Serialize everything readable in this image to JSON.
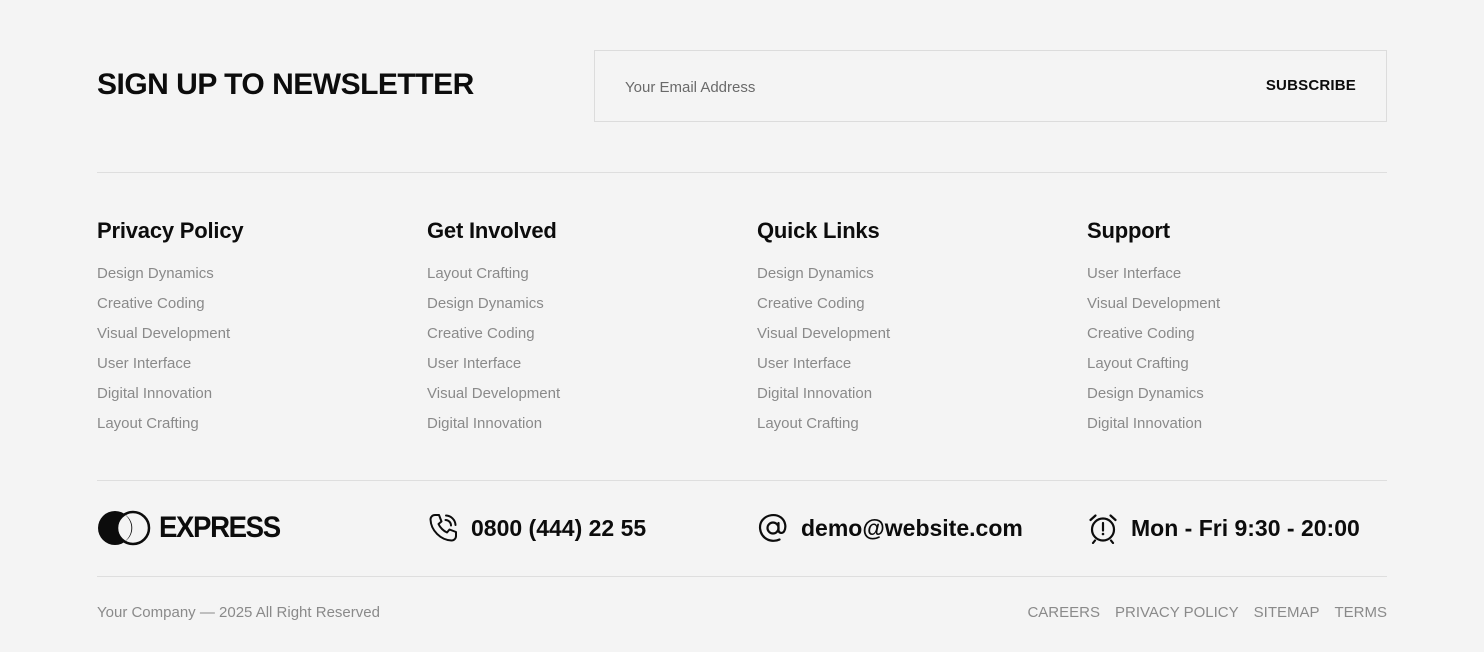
{
  "newsletter": {
    "title": "SIGN UP TO NEWSLETTER",
    "email_placeholder": "Your Email Address",
    "subscribe_label": "SUBSCRIBE"
  },
  "columns": [
    {
      "title": "Privacy Policy",
      "links": [
        "Design Dynamics",
        "Creative Coding",
        "Visual Development",
        "User Interface",
        "Digital Innovation",
        "Layout Crafting"
      ]
    },
    {
      "title": "Get Involved",
      "links": [
        "Layout Crafting",
        "Design Dynamics",
        "Creative Coding",
        "User Interface",
        "Visual Development",
        "Digital Innovation"
      ]
    },
    {
      "title": "Quick Links",
      "links": [
        "Design Dynamics",
        "Creative Coding",
        "Visual Development",
        "User Interface",
        "Digital Innovation",
        "Layout Crafting"
      ]
    },
    {
      "title": "Support",
      "links": [
        "User Interface",
        "Visual Development",
        "Creative Coding",
        "Layout Crafting",
        "Design Dynamics",
        "Digital Innovation"
      ]
    }
  ],
  "contact": {
    "logo_text": "EXPRESS",
    "phone": "0800 (444) 22 55",
    "email": "demo@website.com",
    "hours": "Mon - Fri 9:30 - 20:00",
    "icons": {
      "phone": "phone-icon",
      "email": "at-sign-icon",
      "hours": "alarm-clock-icon"
    }
  },
  "bottom": {
    "copyright": "Your Company — 2025 All Right Reserved",
    "links": [
      "CAREERS",
      "PRIVACY POLICY",
      "SITEMAP",
      "TERMS"
    ]
  },
  "colors": {
    "background": "#f4f4f4",
    "heading": "#0c0c0c",
    "muted": "#8a8a8a",
    "divider": "#dedede"
  }
}
